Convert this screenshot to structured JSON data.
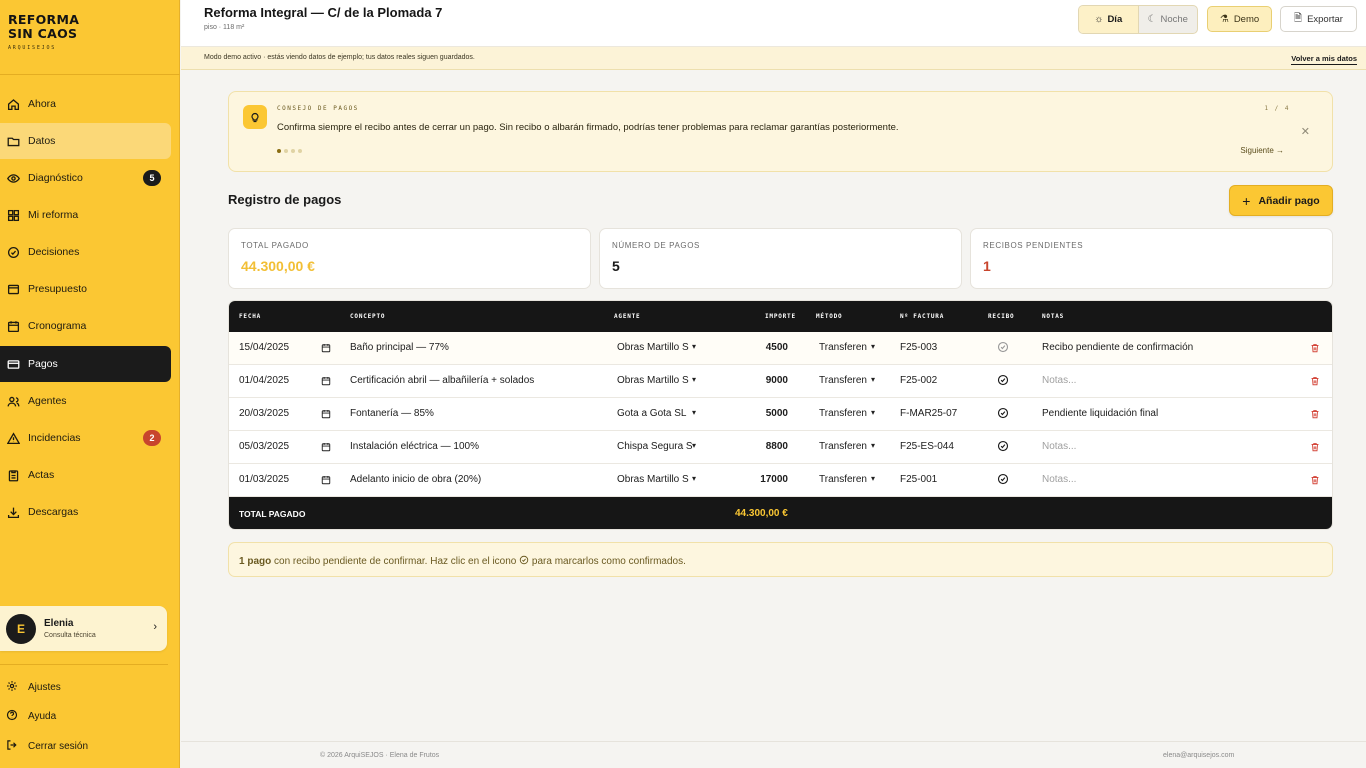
{
  "brand": {
    "title_line1": "REFORMA",
    "title_line2": "SIN CAOS",
    "subtitle": "ARQUISEJOS"
  },
  "sidebar": {
    "items": [
      {
        "label": "Ahora",
        "icon": "home-icon"
      },
      {
        "label": "Datos",
        "icon": "folder-icon"
      },
      {
        "label": "Diagnóstico",
        "icon": "eye-icon",
        "badge": "5"
      },
      {
        "label": "Mi reforma",
        "icon": "grid-icon"
      },
      {
        "label": "Decisiones",
        "icon": "check-circle-icon"
      },
      {
        "label": "Presupuesto",
        "icon": "wallet-icon"
      },
      {
        "label": "Cronograma",
        "icon": "calendar-icon"
      },
      {
        "label": "Pagos",
        "icon": "card-icon"
      },
      {
        "label": "Agentes",
        "icon": "users-icon"
      },
      {
        "label": "Incidencias",
        "icon": "warning-icon",
        "badge": "2"
      },
      {
        "label": "Actas",
        "icon": "clipboard-icon"
      },
      {
        "label": "Descargas",
        "icon": "download-icon"
      }
    ],
    "user": {
      "initial": "E",
      "name": "Elenia",
      "role": "Consulta técnica"
    },
    "bottom": {
      "settings": "Ajustes",
      "help": "Ayuda",
      "logout": "Cerrar sesión"
    }
  },
  "header": {
    "title": "Reforma Integral — C/ de la Plomada 7",
    "subtitle": "piso · 118 m²",
    "day_label": "Día",
    "night_label": "Noche",
    "demo_label": "Demo",
    "export_label": "Exportar"
  },
  "demo_banner": {
    "text": "Modo demo activo · estás viendo datos de ejemplo; tus datos reales siguen guardados.",
    "link": "Volver a mis datos"
  },
  "tip": {
    "label": "CONSEJO DE PAGOS",
    "text": "Confirma siempre el recibo antes de cerrar un pago. Sin recibo o albarán firmado, podrías tener problemas para reclamar garantías posteriormente.",
    "counter": "1 / 4",
    "next": "Siguiente →"
  },
  "section": {
    "title": "Registro de pagos",
    "add_label": "Añadir pago"
  },
  "stats": {
    "total_label": "TOTAL PAGADO",
    "total_value": "44.300,00 €",
    "count_label": "NÚMERO DE PAGOS",
    "count_value": "5",
    "pending_label": "RECIBOS PENDIENTES",
    "pending_value": "1"
  },
  "table": {
    "headers": [
      "FECHA",
      "CONCEPTO",
      "AGENTE",
      "IMPORTE",
      "MÉTODO",
      "Nº FACTURA",
      "RECIBO",
      "NOTAS"
    ],
    "rows": [
      {
        "date": "15/04/2025",
        "concept": "Baño principal — 77%",
        "agent": "Obras Martillo S",
        "amount": "4500",
        "method": "Transferen",
        "invoice": "F25-003",
        "receipt": "pending",
        "notes": "Recibo pendiente de confirmación",
        "notes_placeholder": false
      },
      {
        "date": "01/04/2025",
        "concept": "Certificación abril — albañilería + solados",
        "agent": "Obras Martillo S",
        "amount": "9000",
        "method": "Transferen",
        "invoice": "F25-002",
        "receipt": "confirmed",
        "notes": "Notas...",
        "notes_placeholder": true
      },
      {
        "date": "20/03/2025",
        "concept": "Fontanería — 85%",
        "agent": "Gota a Gota SL",
        "amount": "5000",
        "method": "Transferen",
        "invoice": "F-MAR25-07",
        "receipt": "confirmed",
        "notes": "Pendiente liquidación final",
        "notes_placeholder": false
      },
      {
        "date": "05/03/2025",
        "concept": "Instalación eléctrica — 100%",
        "agent": "Chispa Segura S",
        "amount": "8800",
        "method": "Transferen",
        "invoice": "F25-ES-044",
        "receipt": "confirmed",
        "notes": "Notas...",
        "notes_placeholder": true
      },
      {
        "date": "01/03/2025",
        "concept": "Adelanto inicio de obra (20%)",
        "agent": "Obras Martillo S",
        "amount": "17000",
        "method": "Transferen",
        "invoice": "F25-001",
        "receipt": "confirmed",
        "notes": "Notas...",
        "notes_placeholder": true
      }
    ],
    "footer_label": "TOTAL PAGADO",
    "footer_value": "44.300,00 €"
  },
  "notice": {
    "bold": "1 pago",
    "text_before": " con recibo pendiente de confirmar. Haz clic en el icono ",
    "text_after": " para marcarlos como confirmados."
  },
  "footer": {
    "left": "© 2026 ArquiSEJOS · Elena de Frutos",
    "right": "elena@arquisejos.com"
  },
  "colors": {
    "accent": "#fbc733",
    "dark": "#161616",
    "danger": "#c8452d"
  }
}
